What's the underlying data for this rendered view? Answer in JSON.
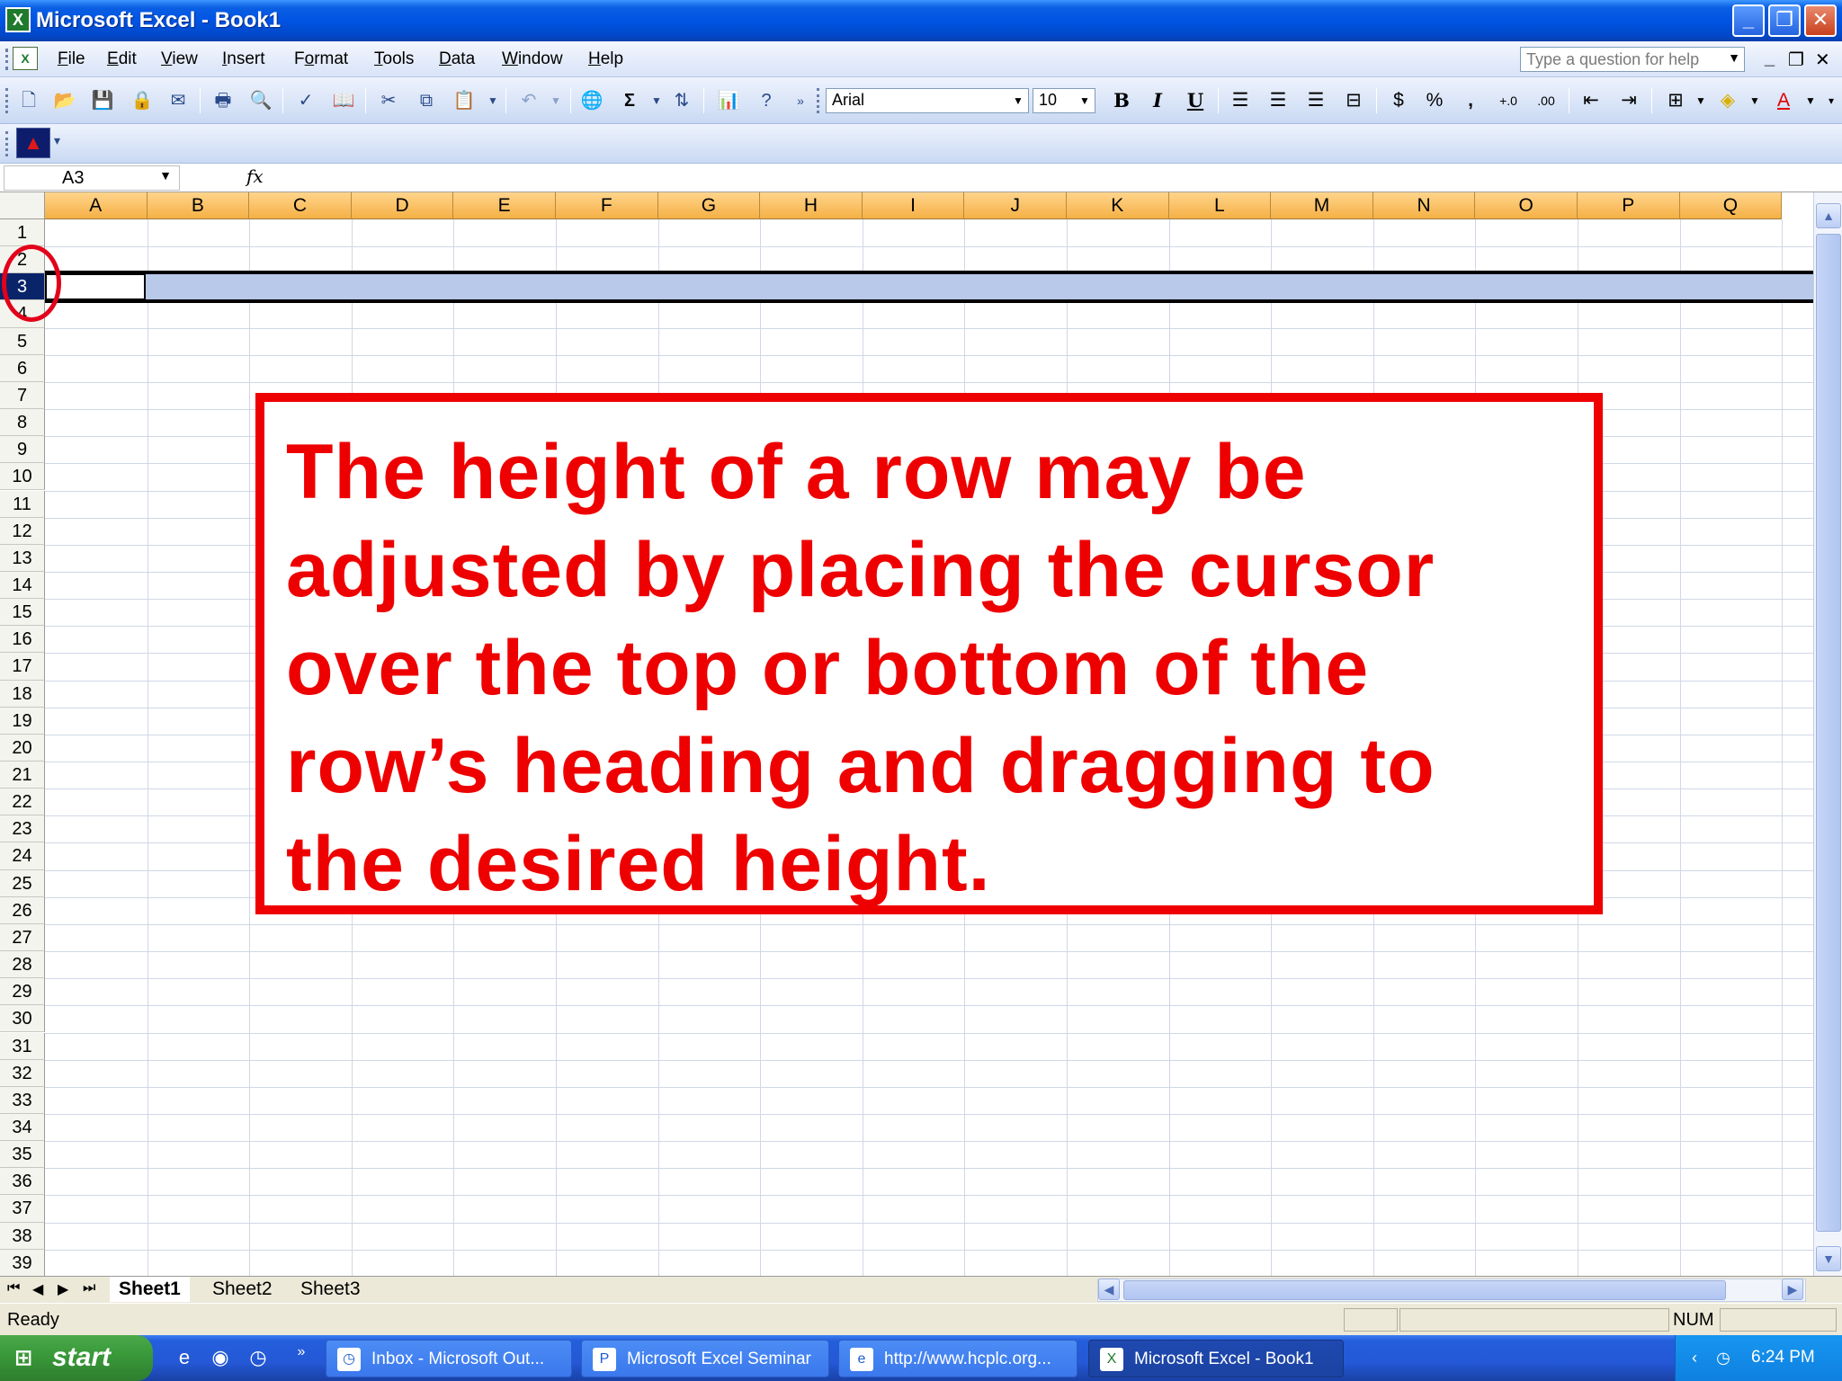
{
  "window": {
    "title": "Microsoft Excel - Book1",
    "app_icon": "excel-icon"
  },
  "menubar": {
    "items": [
      {
        "label": "File",
        "accel": "F"
      },
      {
        "label": "Edit",
        "accel": "E"
      },
      {
        "label": "View",
        "accel": "V"
      },
      {
        "label": "Insert",
        "accel": "I"
      },
      {
        "label": "Format",
        "accel": "o"
      },
      {
        "label": "Tools",
        "accel": "T"
      },
      {
        "label": "Data",
        "accel": "D"
      },
      {
        "label": "Window",
        "accel": "W"
      },
      {
        "label": "Help",
        "accel": "H"
      }
    ],
    "help_placeholder": "Type a question for help"
  },
  "toolbar": {
    "font_name": "Arial",
    "font_size": "10",
    "bold": "B",
    "italic": "I",
    "underline": "U",
    "currency": "$",
    "percent": "%",
    "comma": ",",
    "autosum": "Σ"
  },
  "formula_bar": {
    "name_box": "A3",
    "fx_label": "fx"
  },
  "grid": {
    "columns": [
      "A",
      "B",
      "C",
      "D",
      "E",
      "F",
      "G",
      "H",
      "I",
      "J",
      "K",
      "L",
      "M",
      "N",
      "O",
      "P",
      "Q"
    ],
    "rows": [
      "1",
      "2",
      "3",
      "4",
      "5",
      "6",
      "7",
      "8",
      "9",
      "10",
      "11",
      "12",
      "13",
      "14",
      "15",
      "16",
      "17",
      "18",
      "19",
      "20",
      "21",
      "22",
      "23",
      "24",
      "25",
      "26",
      "27",
      "28",
      "29",
      "30",
      "31",
      "32",
      "33",
      "34",
      "35",
      "36",
      "37",
      "38",
      "39"
    ],
    "selected_row": "3"
  },
  "callout": {
    "lines": [
      "The height of a row may be",
      "adjusted by placing the cursor",
      "over the top or bottom of the",
      "row’s heading and dragging to",
      "the desired height."
    ],
    "color": "#ee0000"
  },
  "sheets": {
    "tabs": [
      "Sheet1",
      "Sheet2",
      "Sheet3"
    ],
    "active": "Sheet1"
  },
  "status": {
    "ready": "Ready",
    "num": "NUM"
  },
  "taskbar": {
    "start_label": "start",
    "tasks": [
      {
        "label": "Inbox - Microsoft Out...",
        "icon": "outlook-icon"
      },
      {
        "label": "Microsoft Excel Seminar",
        "icon": "powerpoint-icon"
      },
      {
        "label": "http://www.hcplc.org...",
        "icon": "internet-explorer-icon"
      },
      {
        "label": "Microsoft Excel - Book1",
        "icon": "excel-icon"
      }
    ],
    "clock": "6:24 PM"
  }
}
